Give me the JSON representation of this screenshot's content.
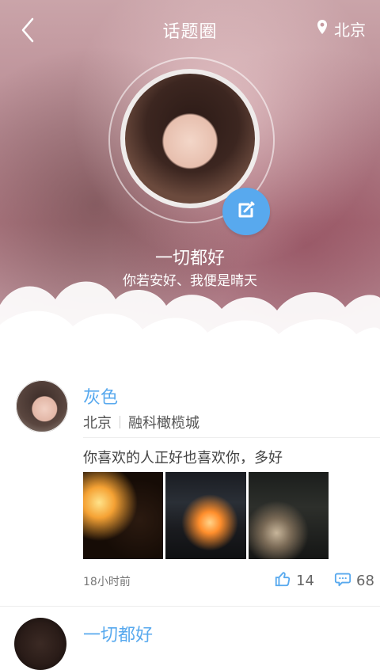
{
  "topbar": {
    "title": "话题圈",
    "location": "北京"
  },
  "profile": {
    "name": "一切都好",
    "motto": "你若安好、我便是晴天"
  },
  "posts": [
    {
      "name": "灰色",
      "city": "北京",
      "place": "融科橄榄城",
      "text": "你喜欢的人正好也喜欢你，多好",
      "time": "18小时前",
      "likes": "14",
      "comments": "68"
    },
    {
      "name": "一切都好"
    }
  ],
  "colors": {
    "accent": "#58a9ee"
  },
  "icons": {
    "back": "chevron-left-icon",
    "location": "location-pin-icon",
    "edit": "edit-icon",
    "like": "thumbs-up-icon",
    "comment": "comment-bubble-icon"
  }
}
